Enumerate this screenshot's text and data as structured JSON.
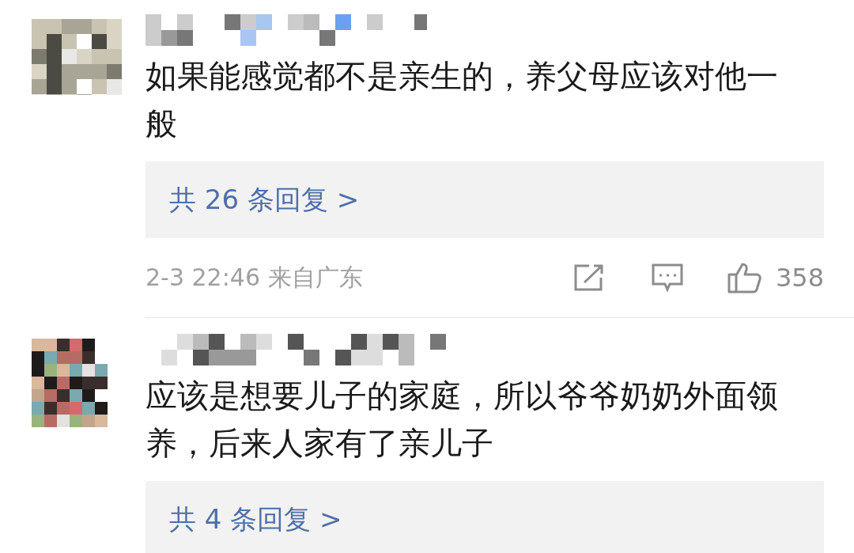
{
  "comments": [
    {
      "text": "如果能感觉都不是亲生的，养父母应该对他一般",
      "replies": "共 26 条回复 >",
      "time": "2-3 22:46 来自广东",
      "likes": "358"
    },
    {
      "text": "应该是想要儿子的家庭，所以爷爷奶奶外面领养，后来人家有了亲儿子",
      "replies": "共 4 条回复 >"
    }
  ]
}
